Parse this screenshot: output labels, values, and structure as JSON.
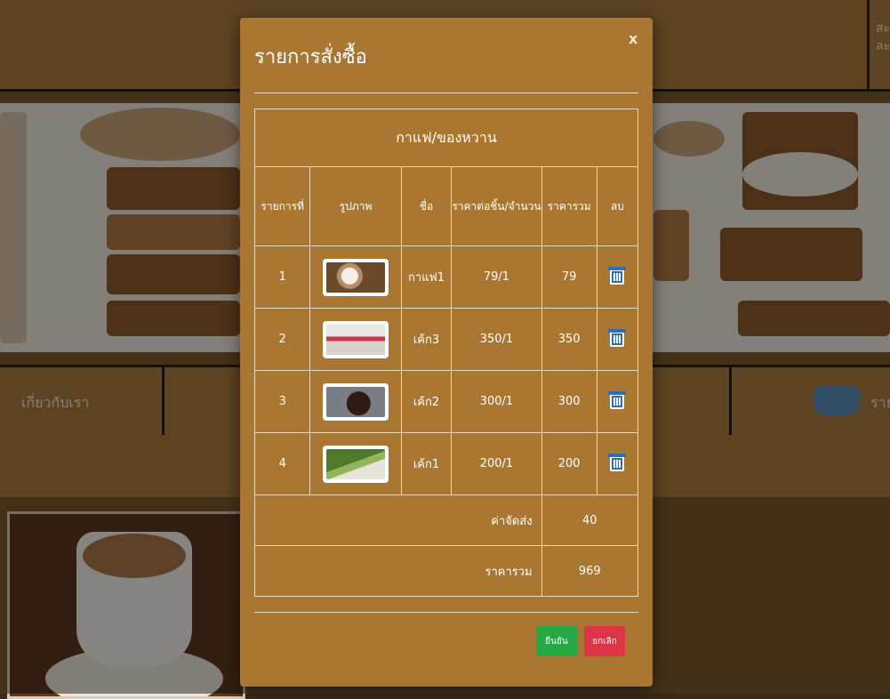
{
  "background": {
    "header_side_text": "สะ\nละ",
    "nav_about": "เกี่ยวกับเรา",
    "nav_partial_right": "รายก"
  },
  "modal": {
    "title": "รายการสั่งซื้อ",
    "close_label": "x",
    "category": "กาแฟ/ของหวาน",
    "columns": {
      "index": "รายการที่",
      "image": "รูปภาพ",
      "name": "ชื่อ",
      "price_qty": "ราคาต่อชิ้น/จำนวน",
      "total": "ราคารวม",
      "delete": "ลบ"
    },
    "rows": [
      {
        "index": "1",
        "name": "กาแฟ1",
        "price_qty": "79/1",
        "total": "79"
      },
      {
        "index": "2",
        "name": "เค้ก3",
        "price_qty": "350/1",
        "total": "350"
      },
      {
        "index": "3",
        "name": "เค้ก2",
        "price_qty": "300/1",
        "total": "300"
      },
      {
        "index": "4",
        "name": "เค้ก1",
        "price_qty": "200/1",
        "total": "200"
      }
    ],
    "shipping_label": "ค่าจัดส่ง",
    "shipping_value": "40",
    "grand_total_label": "ราคารวม",
    "grand_total_value": "969",
    "confirm_label": "ยืนยัน",
    "cancel_label": "ยกเลิก"
  },
  "colors": {
    "modal_bg": "#a97732",
    "confirm_button": "#28a745",
    "cancel_button": "#dc3545",
    "trash_icon": "#2a6fb8"
  }
}
